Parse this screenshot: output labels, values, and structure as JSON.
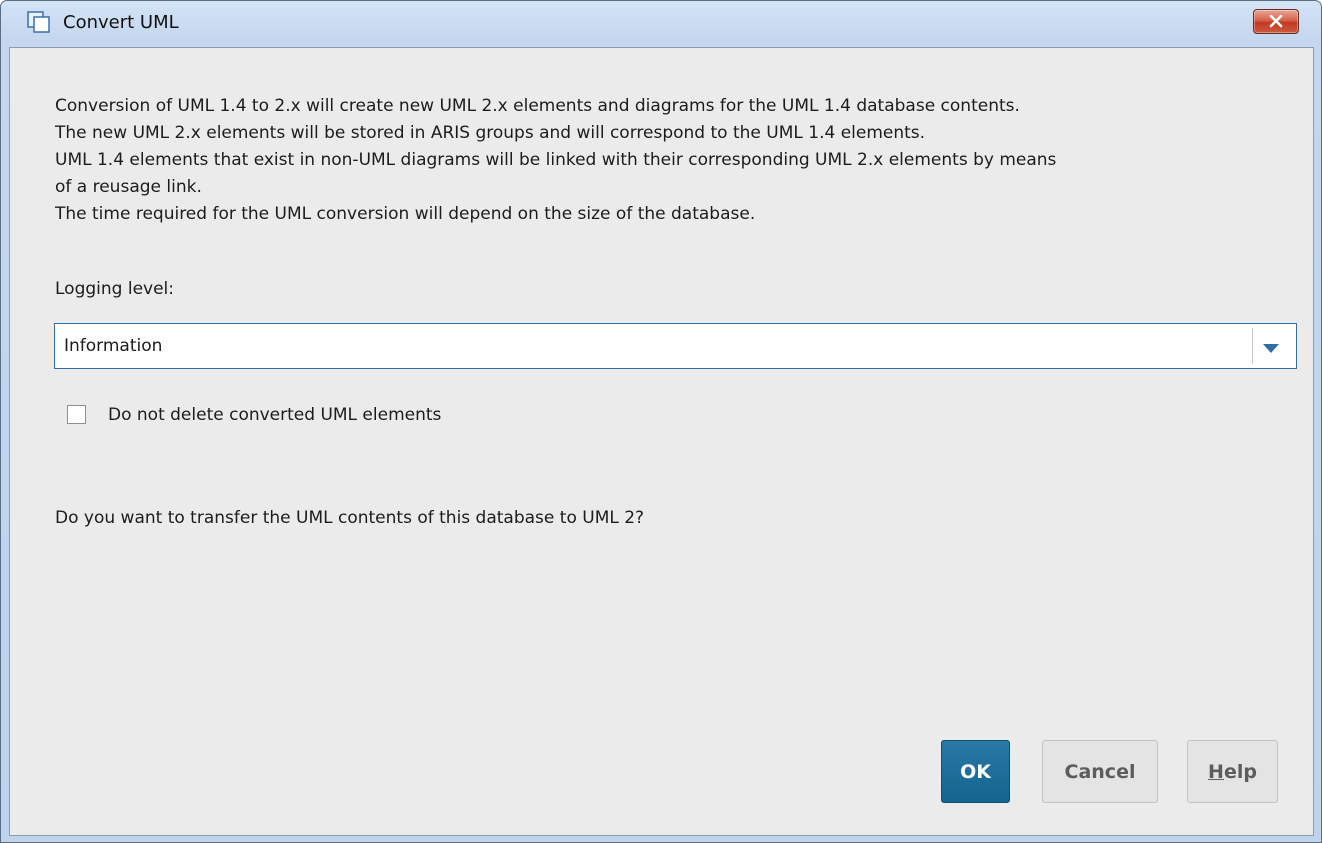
{
  "window": {
    "title": "Convert UML",
    "title_icon": "window-icon",
    "close_icon": "close-x-icon"
  },
  "dialog": {
    "description_lines": [
      "Conversion of UML 1.4 to 2.x will create new UML 2.x elements and diagrams for the UML 1.4 database contents.",
      "The new UML 2.x elements will be stored in ARIS groups and will correspond to the UML 1.4 elements.",
      "UML 1.4 elements that exist in non-UML diagrams will be linked with their corresponding UML 2.x elements by means",
      "of a reusage link.",
      "The time required for the UML conversion will depend on the size of the database."
    ],
    "logging_label": "Logging level:",
    "logging_value": "Information",
    "checkbox_label": "Do not delete converted UML elements",
    "checkbox_checked": false,
    "question": "Do you want to transfer the UML contents of this database to UML 2?"
  },
  "buttons": {
    "ok": "OK",
    "cancel": "Cancel",
    "help_mnemonic": "H",
    "help_rest": "elp"
  },
  "colors": {
    "primary_button": "#14648f",
    "close_button": "#c13b24",
    "focus_border": "#2f6fa3"
  }
}
